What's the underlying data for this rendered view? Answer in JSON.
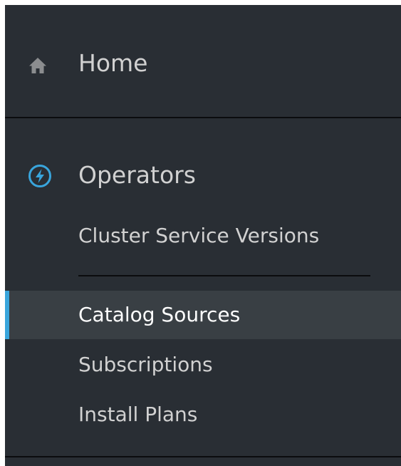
{
  "nav": {
    "home": {
      "icon": "home-icon",
      "label": "Home"
    },
    "operators": {
      "icon": "operators-bolt-icon",
      "label": "Operators",
      "icon_color": "#39a5dc",
      "items": [
        {
          "label": "Cluster Service Versions",
          "active": false
        },
        {
          "label": "Catalog Sources",
          "active": true
        },
        {
          "label": "Subscriptions",
          "active": false
        },
        {
          "label": "Install Plans",
          "active": false
        }
      ]
    }
  },
  "colors": {
    "nav_background": "#292e34",
    "active_background": "#393f44",
    "active_indicator": "#39a5dc",
    "text": "#d1d1d1",
    "text_active": "#ffffff"
  }
}
